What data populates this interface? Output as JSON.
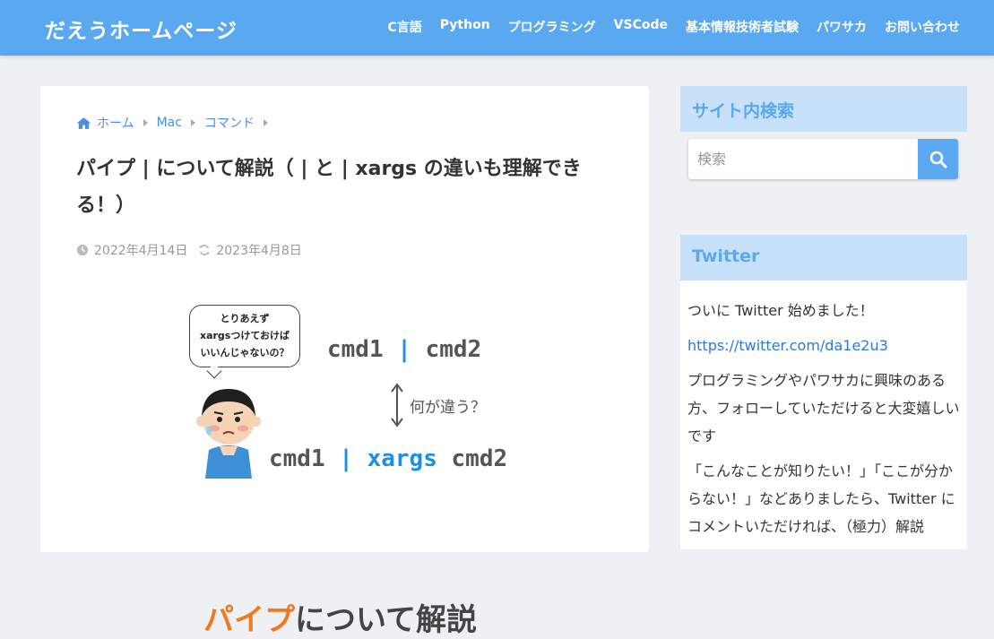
{
  "site": {
    "title": "だえうホームページ"
  },
  "nav": [
    {
      "label": "C言語"
    },
    {
      "label": "Python"
    },
    {
      "label": "プログラミング"
    },
    {
      "label": "VSCode"
    },
    {
      "label": "基本情報技術者試験"
    },
    {
      "label": "パワサカ"
    },
    {
      "label": "お問い合わせ"
    }
  ],
  "breadcrumb": {
    "home": "ホーム",
    "items": [
      "Mac",
      "コマンド"
    ]
  },
  "article": {
    "title": "パイプ | について解説（ | と | xargs の違いも理解できる！）",
    "published": "2022年4月14日",
    "updated": "2023年4月8日"
  },
  "eyecatch": {
    "bubble_lines": [
      "とりあえず",
      "xargsつけておけば",
      "いいんじゃないの？"
    ],
    "cmd_top_a": "cmd1",
    "cmd_top_pipe": "|",
    "cmd_top_b": "cmd2",
    "diff_label": "何が違う？",
    "cmd_bottom_a": "cmd1",
    "cmd_bottom_pipe": "|",
    "cmd_bottom_xargs": "xargs",
    "cmd_bottom_b": "cmd2",
    "big_title_accent": "パイプ",
    "big_title_rest": "について解説"
  },
  "sidebar": {
    "search": {
      "heading": "サイト内検索",
      "placeholder": "検索"
    },
    "twitter": {
      "heading": "Twitter",
      "line1": "ついに Twitter 始めました！",
      "link": "https://twitter.com/da1e2u3",
      "line2": "プログラミングやパワサカに興味のある方、フォローしていただけると大変嬉しいです",
      "line3": "「こんなことが知りたい！」「ここが分からない！」などありましたら、Twitter にコメントいただければ、（極力）解説"
    }
  },
  "colors": {
    "brand": "#5aa8f0",
    "sidebar_head_bg": "#c7e1fa",
    "accent_orange": "#f07820",
    "pipe_blue": "#1b8ee6"
  }
}
